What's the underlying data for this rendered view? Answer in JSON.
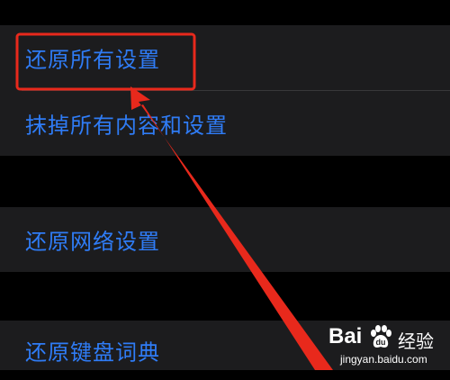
{
  "settings": {
    "group1": {
      "items": [
        {
          "label": "还原所有设置"
        },
        {
          "label": "抹掉所有内容和设置"
        }
      ]
    },
    "group2": {
      "items": [
        {
          "label": "还原网络设置"
        }
      ]
    },
    "group3": {
      "items": [
        {
          "label": "还原键盘词典"
        }
      ]
    }
  },
  "annotation": {
    "highlight_color": "#e8291c",
    "target": "还原所有设置"
  },
  "watermark": {
    "brand": "Bai",
    "suffix": "经验",
    "url": "jingyan.baidu.com",
    "icon": "baidu-paw-icon"
  },
  "colors": {
    "background": "#000000",
    "cell": "#1c1c1e",
    "link": "#2f7cf6",
    "separator": "#38383a"
  }
}
